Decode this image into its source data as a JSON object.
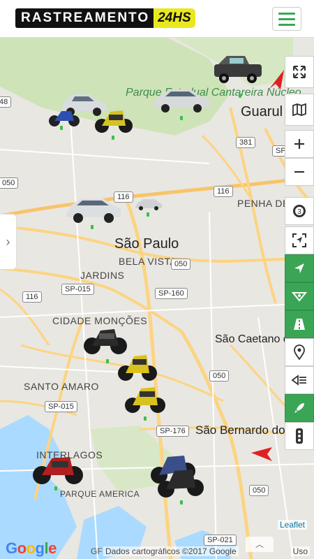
{
  "header": {
    "logo_part1": "RASTREAMENTO",
    "logo_part2": "24HS"
  },
  "map": {
    "cities": [
      "São Paulo",
      "São Caetano do Sul",
      "São Bernardo do Campo",
      "Guarul"
    ],
    "districts": [
      "PENHA DE FRANCA",
      "BELA VISTA",
      "JARDINS",
      "CIDADE MONÇÕES",
      "SANTO AMARO",
      "INTERLAGOS",
      "PARQUE AMERICA"
    ],
    "park_label": "Parque Estadual Cantareira Núcleo...",
    "road_shields": [
      "48",
      "381",
      "SP-",
      "050",
      "116",
      "116",
      "050",
      "SP-015",
      "SP-160",
      "116",
      "SP-015",
      "SP-176",
      "050",
      "050",
      "SP-021"
    ],
    "attribution": "Dados cartográficos ©2017 Google",
    "leaflet": "Leaflet",
    "terms": "Uso",
    "google": "Google",
    "gf": "GF",
    "colors": {
      "accent": "#3aa655",
      "water": "#aadaff",
      "park": "#c8dfb0",
      "road": "#fcd481"
    }
  },
  "controls": [
    {
      "icon": "fullscreen-icon"
    },
    {
      "icon": "map-layers-icon"
    },
    {
      "icon": "zoom-in-icon"
    },
    {
      "icon": "zoom-out-icon"
    },
    {
      "icon": "refresh-counter-icon",
      "value": "3"
    },
    {
      "icon": "fit-bounds-icon"
    },
    {
      "icon": "navigate-icon"
    },
    {
      "icon": "route-icon"
    },
    {
      "icon": "road-icon"
    },
    {
      "icon": "location-pin-icon"
    },
    {
      "icon": "history-icon"
    },
    {
      "icon": "rocket-icon"
    },
    {
      "icon": "traffic-light-icon"
    }
  ]
}
